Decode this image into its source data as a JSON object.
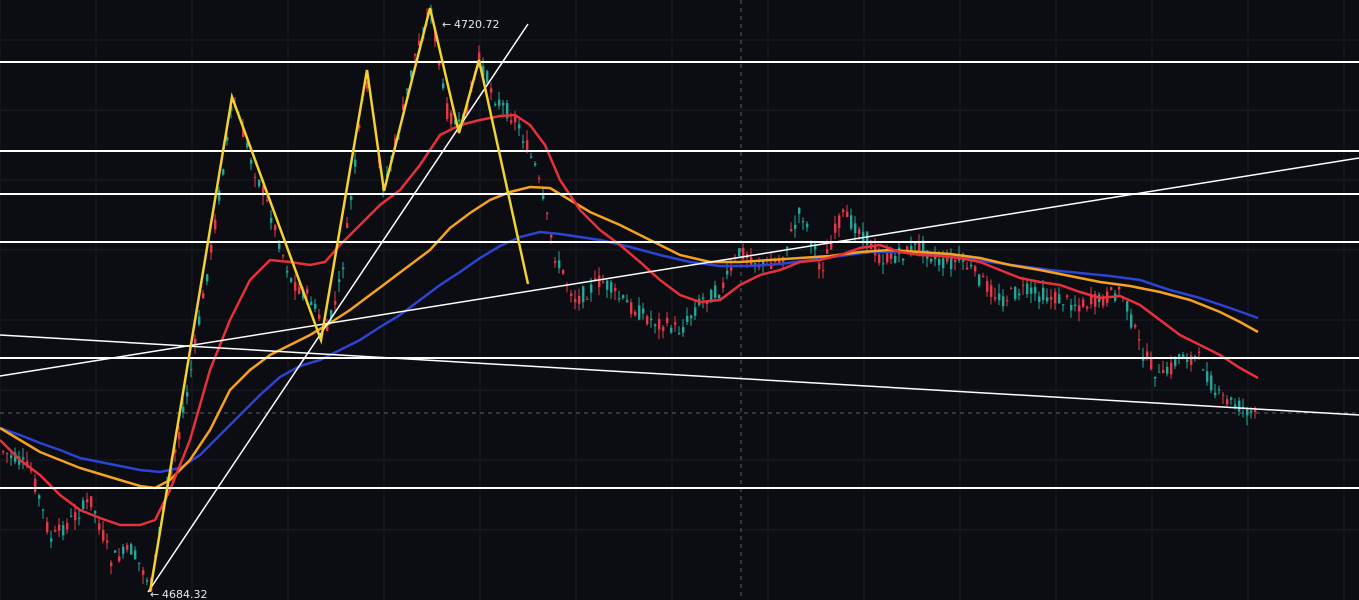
{
  "chart_data": {
    "type": "candlestick",
    "annotations": {
      "high": {
        "label": "4720.72",
        "value": 4720.72
      },
      "low": {
        "label": "4684.32",
        "value": 4684.32
      }
    },
    "ylim": [
      4684.0,
      4722.0
    ],
    "grid": true,
    "ma_series_colors": {
      "fast": "#e8303a",
      "mid": "#f5a21f",
      "slow": "#2c44d6"
    },
    "drawing_colors": {
      "zigzag": "#f2d230",
      "lines": "#ffffff",
      "bull": "#26a69a",
      "bear": "#e23a4a"
    }
  }
}
